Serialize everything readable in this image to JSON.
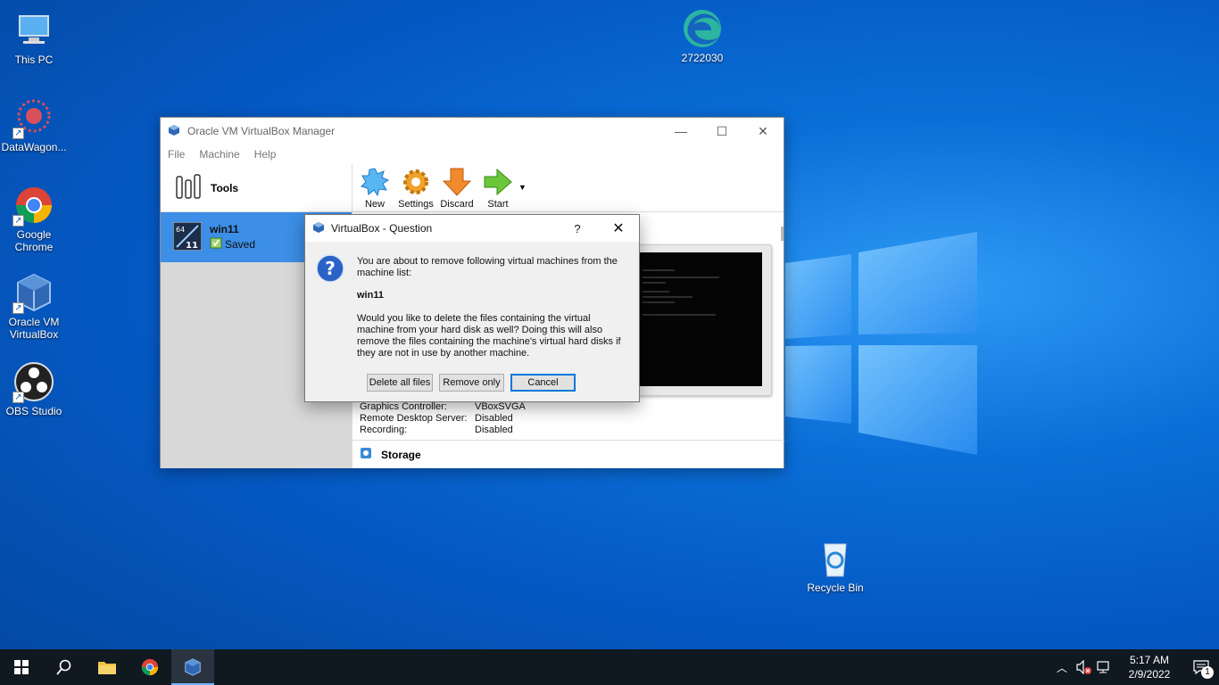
{
  "desktop": {
    "icons": [
      {
        "label": "This PC",
        "icon": "this-pc-icon"
      },
      {
        "label": "DataWagon...",
        "icon": "datawagon-icon"
      },
      {
        "label": "Google Chrome",
        "icon": "chrome-icon"
      },
      {
        "label": "Oracle VM VirtualBox",
        "icon": "virtualbox-icon"
      },
      {
        "label": "OBS Studio",
        "icon": "obs-icon"
      },
      {
        "label": "2722030",
        "icon": "edge-icon"
      },
      {
        "label": "Recycle Bin",
        "icon": "recycle-bin-icon"
      }
    ]
  },
  "vbox": {
    "title": "Oracle VM VirtualBox Manager",
    "menu": [
      "File",
      "Machine",
      "Help"
    ],
    "tools_label": "Tools",
    "toolbar": {
      "new": "New",
      "settings": "Settings",
      "discard": "Discard",
      "start": "Start"
    },
    "vm": {
      "name": "win11",
      "state": "Saved",
      "badge_top": "64",
      "badge_bottom": "11"
    },
    "details": [
      {
        "key": "Graphics Controller:",
        "value": "VBoxSVGA"
      },
      {
        "key": "Remote Desktop Server:",
        "value": "Disabled"
      },
      {
        "key": "Recording:",
        "value": "Disabled"
      }
    ],
    "storage_label": "Storage"
  },
  "dialog": {
    "title": "VirtualBox - Question",
    "help": "?",
    "message1": "You are about to remove following virtual machines from the machine list:",
    "vm_name": "win11",
    "message2": "Would you like to delete the files containing the virtual machine from your hard disk as well? Doing this will also remove the files containing the machine's virtual hard disks if they are not in use by another machine.",
    "buttons": {
      "delete_all": "Delete all files",
      "remove_only": "Remove only",
      "cancel": "Cancel"
    }
  },
  "taskbar": {
    "time": "5:17 AM",
    "date": "2/9/2022",
    "notifications": "1"
  },
  "colors": {
    "accent": "#0078d7",
    "selection": "#3c8ee6",
    "taskbar": "#101820"
  }
}
